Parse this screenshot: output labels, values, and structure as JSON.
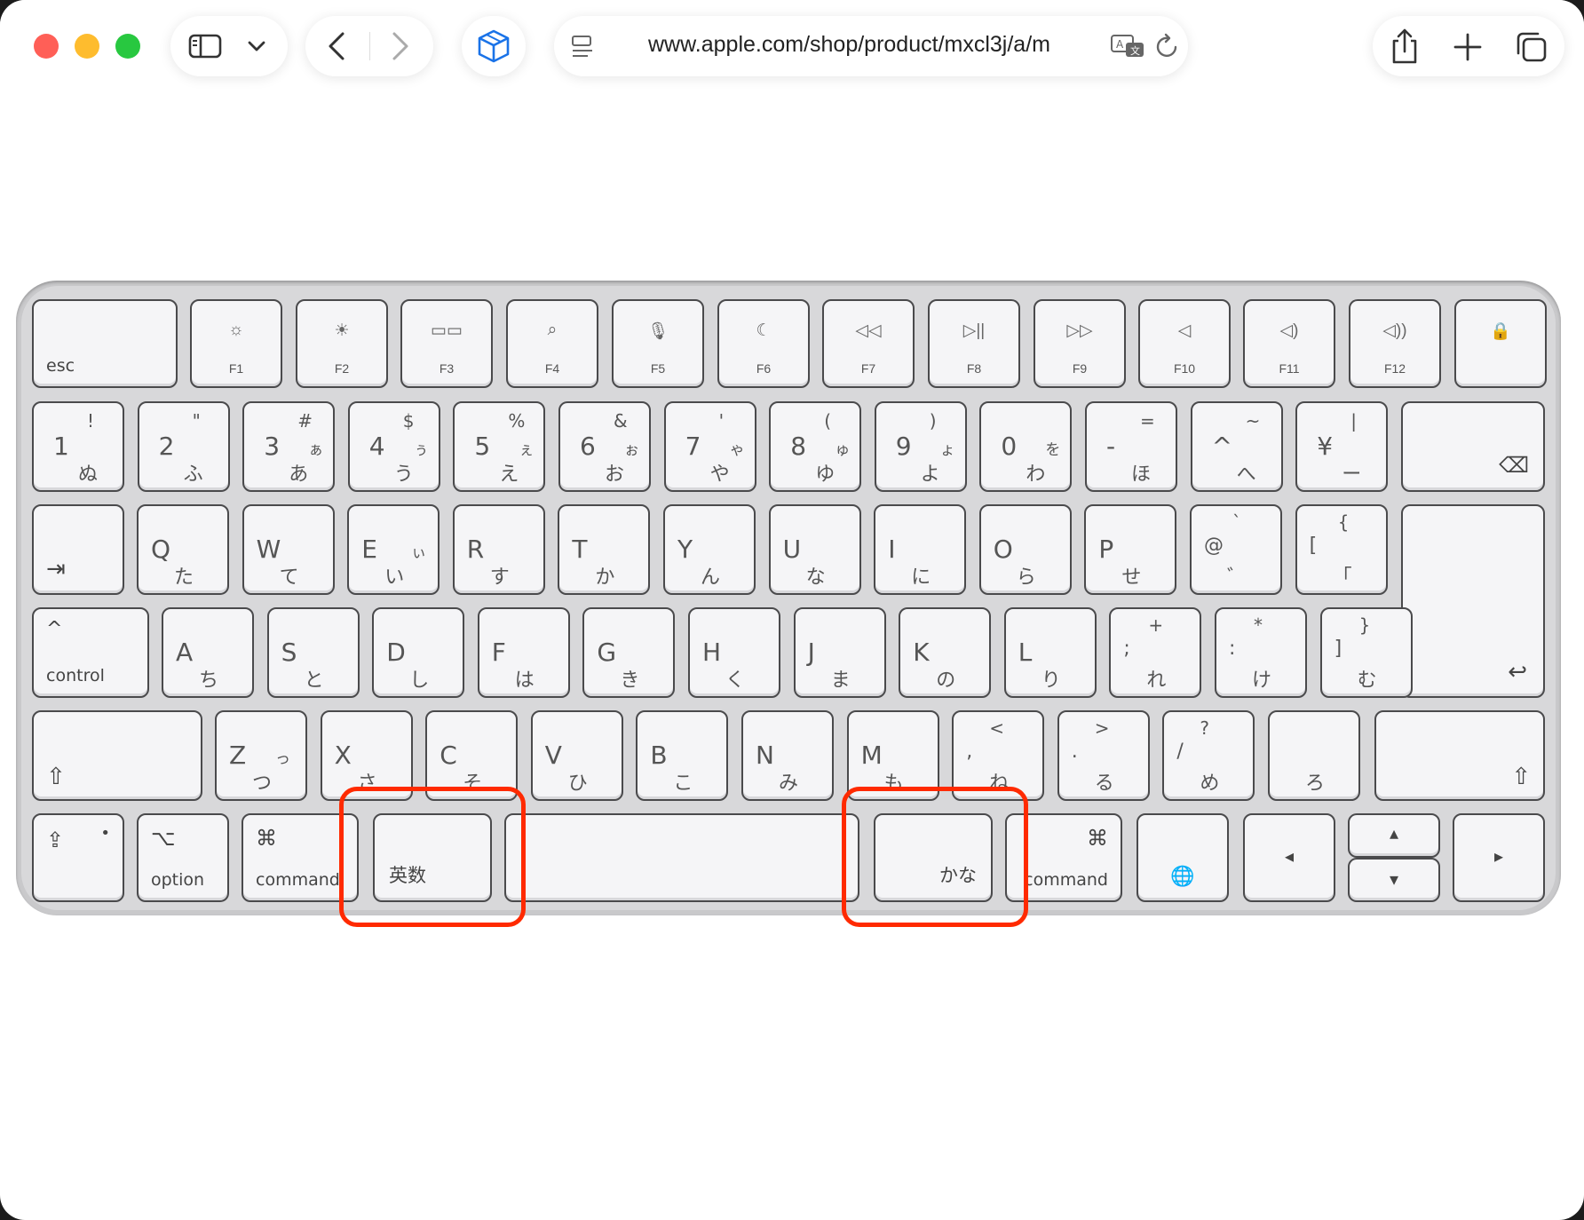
{
  "browser": {
    "url": "www.apple.com/shop/product/mxcl3j/a/m",
    "traffic_lights": {
      "close": "#ff5f57",
      "minimize": "#febc2e",
      "zoom": "#28c840"
    },
    "icons": [
      "sidebar-icon",
      "chevron-down-icon",
      "back-icon",
      "forward-icon",
      "extension-cube-icon",
      "reader-icon",
      "translate-icon",
      "reload-icon",
      "share-icon",
      "new-tab-icon",
      "tabs-overview-icon"
    ]
  },
  "keyboard": {
    "function_row": [
      {
        "id": "esc",
        "label": "esc"
      },
      {
        "id": "f1",
        "label": "F1",
        "icon": "☼"
      },
      {
        "id": "f2",
        "label": "F2",
        "icon": "☀"
      },
      {
        "id": "f3",
        "label": "F3",
        "icon": "▭▭"
      },
      {
        "id": "f4",
        "label": "F4",
        "icon": "⌕"
      },
      {
        "id": "f5",
        "label": "F5",
        "icon": "🎙"
      },
      {
        "id": "f6",
        "label": "F6",
        "icon": "☾"
      },
      {
        "id": "f7",
        "label": "F7",
        "icon": "◁◁"
      },
      {
        "id": "f8",
        "label": "F8",
        "icon": "▷||"
      },
      {
        "id": "f9",
        "label": "F9",
        "icon": "▷▷"
      },
      {
        "id": "f10",
        "label": "F10",
        "icon": "◁"
      },
      {
        "id": "f11",
        "label": "F11",
        "icon": "◁)"
      },
      {
        "id": "f12",
        "label": "F12",
        "icon": "◁))"
      },
      {
        "id": "lock",
        "label": "",
        "icon": "🔒"
      }
    ],
    "number_row": [
      {
        "main": "1",
        "shift": "!",
        "kana": "ぬ",
        "kana_shift": ""
      },
      {
        "main": "2",
        "shift": "\"",
        "kana": "ふ",
        "kana_shift": ""
      },
      {
        "main": "3",
        "shift": "#",
        "kana": "あ",
        "kana_shift": "ぁ"
      },
      {
        "main": "4",
        "shift": "$",
        "kana": "う",
        "kana_shift": "ぅ"
      },
      {
        "main": "5",
        "shift": "%",
        "kana": "え",
        "kana_shift": "ぇ"
      },
      {
        "main": "6",
        "shift": "&",
        "kana": "お",
        "kana_shift": "ぉ"
      },
      {
        "main": "7",
        "shift": "'",
        "kana": "や",
        "kana_shift": "ゃ"
      },
      {
        "main": "8",
        "shift": "(",
        "kana": "ゆ",
        "kana_shift": "ゅ"
      },
      {
        "main": "9",
        "shift": ")",
        "kana": "よ",
        "kana_shift": "ょ"
      },
      {
        "main": "0",
        "shift": "",
        "kana": "わ",
        "kana_shift": "を"
      },
      {
        "main": "-",
        "shift": "=",
        "kana": "ほ",
        "kana_shift": ""
      },
      {
        "main": "^",
        "shift": "~",
        "kana": "へ",
        "kana_shift": ""
      },
      {
        "main": "¥",
        "shift": "|",
        "kana": "ー",
        "kana_shift": ""
      }
    ],
    "backspace_icon": "⌫",
    "q_row": [
      {
        "main": "Q",
        "kana": "た"
      },
      {
        "main": "W",
        "kana": "て"
      },
      {
        "main": "E",
        "kana": "い",
        "kana_shift": "ぃ"
      },
      {
        "main": "R",
        "kana": "す"
      },
      {
        "main": "T",
        "kana": "か"
      },
      {
        "main": "Y",
        "kana": "ん"
      },
      {
        "main": "U",
        "kana": "な"
      },
      {
        "main": "I",
        "kana": "に"
      },
      {
        "main": "O",
        "kana": "ら"
      },
      {
        "main": "P",
        "kana": "せ"
      },
      {
        "main": "@",
        "shift": "`",
        "kana": "゛"
      },
      {
        "main": "[",
        "shift": "{",
        "kana": "「"
      }
    ],
    "tab_icon": "⇥",
    "a_row": [
      {
        "main": "A",
        "kana": "ち"
      },
      {
        "main": "S",
        "kana": "と"
      },
      {
        "main": "D",
        "kana": "し"
      },
      {
        "main": "F",
        "kana": "は"
      },
      {
        "main": "G",
        "kana": "き"
      },
      {
        "main": "H",
        "kana": "く"
      },
      {
        "main": "J",
        "kana": "ま"
      },
      {
        "main": "K",
        "kana": "の"
      },
      {
        "main": "L",
        "kana": "り"
      },
      {
        "main": ";",
        "shift": "+",
        "kana": "れ"
      },
      {
        "main": ":",
        "shift": "*",
        "kana": "け"
      },
      {
        "main": "]",
        "shift": "}",
        "kana": "む"
      }
    ],
    "control_label": "control",
    "control_icon": "^",
    "return_icon": "↩",
    "z_row": [
      {
        "main": "Z",
        "kana": "つ",
        "kana_shift": "っ"
      },
      {
        "main": "X",
        "kana": "さ"
      },
      {
        "main": "C",
        "kana": "そ"
      },
      {
        "main": "V",
        "kana": "ひ"
      },
      {
        "main": "B",
        "kana": "こ"
      },
      {
        "main": "N",
        "kana": "み"
      },
      {
        "main": "M",
        "kana": "も"
      },
      {
        "main": ",",
        "shift": "<",
        "kana": "ね"
      },
      {
        "main": ".",
        "shift": ">",
        "kana": "る"
      },
      {
        "main": "/",
        "shift": "?",
        "kana": "め"
      },
      {
        "main": "",
        "shift": "",
        "kana": "ろ"
      }
    ],
    "shift_icon": "⇧",
    "bottom_row": {
      "fn_icon": "⇪",
      "option_label": "option",
      "option_icon": "⌥",
      "command_label": "command",
      "command_icon": "⌘",
      "eisu_label": "英数",
      "kana_label": "かな",
      "globe_icon": "🌐",
      "arrow_left": "◂",
      "arrow_up": "▴",
      "arrow_down": "▾",
      "arrow_right": "▸"
    },
    "highlight_color": "#ff2a00"
  }
}
